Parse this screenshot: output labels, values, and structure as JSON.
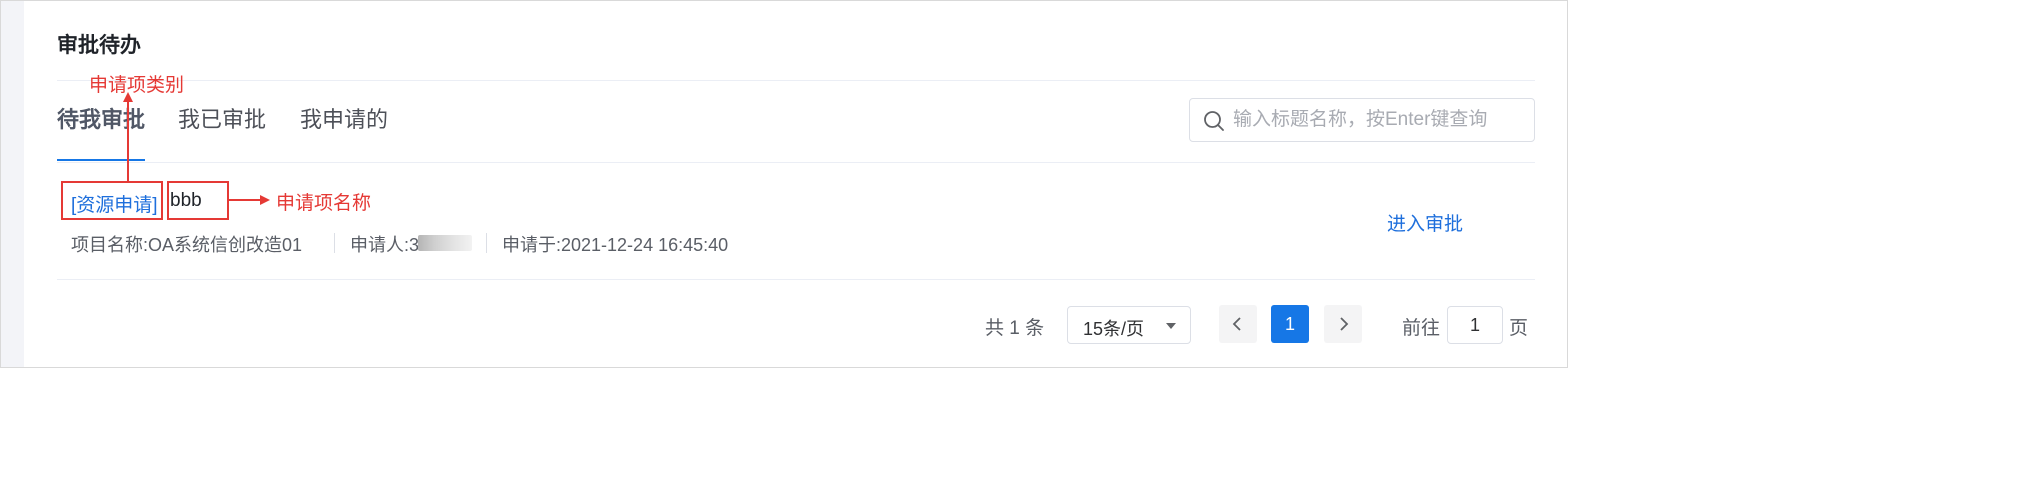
{
  "panel": {
    "title": "审批待办"
  },
  "tabs": [
    {
      "label": "待我审批",
      "active": true
    },
    {
      "label": "我已审批",
      "active": false
    },
    {
      "label": "我申请的",
      "active": false
    }
  ],
  "search": {
    "placeholder": "输入标题名称，按Enter键查询",
    "value": "",
    "icon": "search-icon"
  },
  "item": {
    "category": "[资源申请]",
    "name": "bbb",
    "project": "项目名称:OA系统信创改造01",
    "applicant_label": "申请人:",
    "applicant_first_char": "3",
    "applied_at": "申请于:2021-12-24 16:45:40",
    "action": "进入审批"
  },
  "pagination": {
    "total_text": "共 1 条",
    "page_size": "15条/页",
    "current_page": "1",
    "goto_prefix": "前往",
    "goto_value": "1",
    "goto_suffix": "页"
  },
  "annotations": {
    "category_label": "申请项类别",
    "name_label": "申请项名称",
    "color": "#e53935"
  },
  "colors": {
    "accent": "#1677e6",
    "link": "#1e6fdc"
  }
}
